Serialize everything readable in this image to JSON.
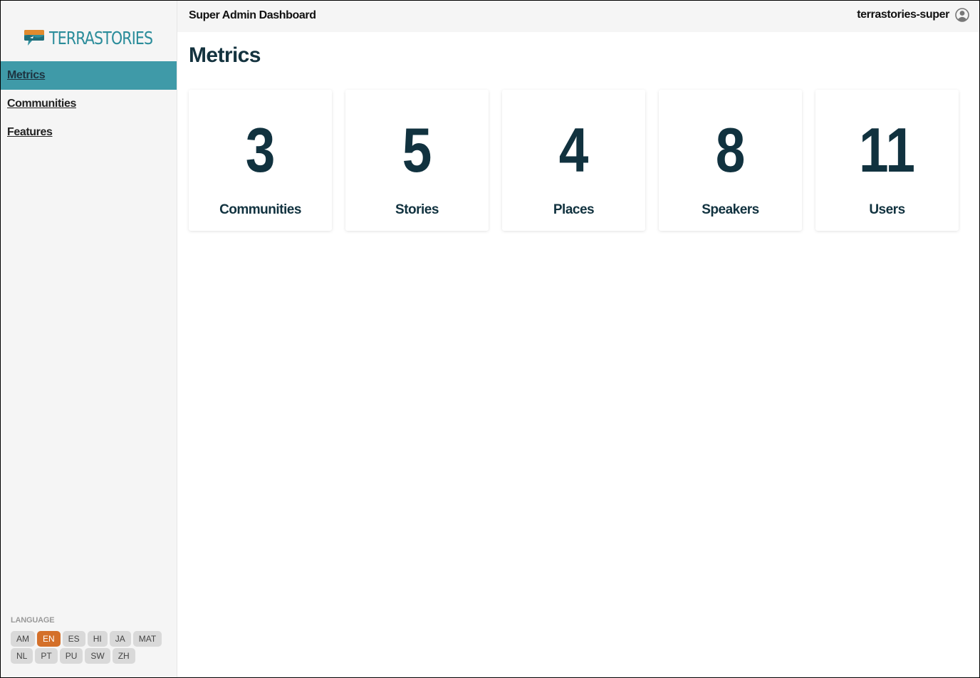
{
  "logo": {
    "text": "TERRASTORIES"
  },
  "sidebar": {
    "items": [
      {
        "label": "Metrics"
      },
      {
        "label": "Communities"
      },
      {
        "label": "Features"
      }
    ]
  },
  "language": {
    "title": "LANGUAGE",
    "selected": "EN",
    "options": [
      {
        "code": "AM"
      },
      {
        "code": "EN"
      },
      {
        "code": "ES"
      },
      {
        "code": "HI"
      },
      {
        "code": "JA"
      },
      {
        "code": "MAT"
      },
      {
        "code": "NL"
      },
      {
        "code": "PT"
      },
      {
        "code": "PU"
      },
      {
        "code": "SW"
      },
      {
        "code": "ZH"
      }
    ]
  },
  "header": {
    "title": "Super Admin Dashboard",
    "username": "terrastories-super"
  },
  "main": {
    "title": "Metrics",
    "metrics": [
      {
        "value": "3",
        "label": "Communities"
      },
      {
        "value": "5",
        "label": "Stories"
      },
      {
        "value": "4",
        "label": "Places"
      },
      {
        "value": "8",
        "label": "Speakers"
      },
      {
        "value": "11",
        "label": "Users"
      }
    ]
  },
  "colors": {
    "accent": "#3f9aa8",
    "language_active": "#d4702a",
    "metric_text": "#11323f"
  }
}
